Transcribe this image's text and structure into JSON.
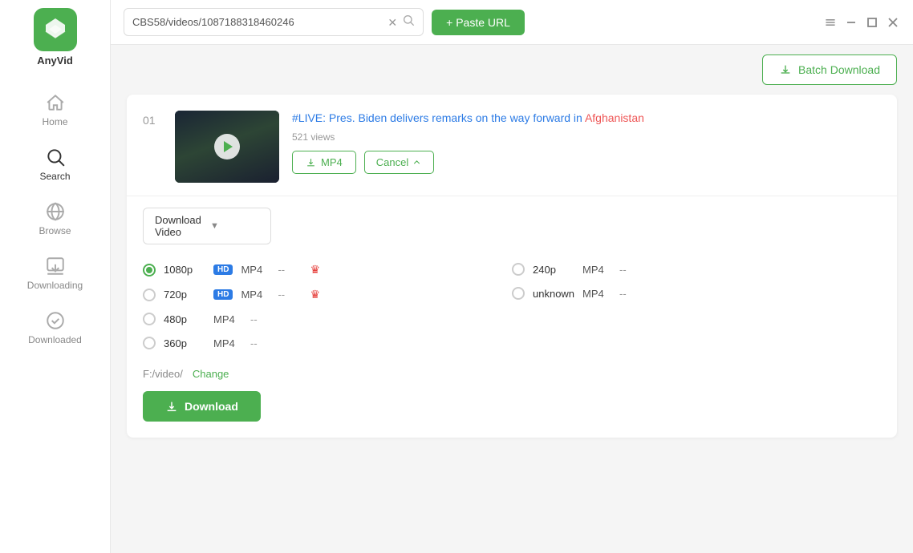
{
  "app": {
    "name": "AnyVid",
    "logo_alt": "AnyVid logo"
  },
  "sidebar": {
    "items": [
      {
        "id": "home",
        "label": "Home",
        "icon": "home-icon"
      },
      {
        "id": "search",
        "label": "Search",
        "icon": "search-icon",
        "active": true
      },
      {
        "id": "browse",
        "label": "Browse",
        "icon": "browse-icon"
      },
      {
        "id": "downloading",
        "label": "Downloading",
        "icon": "downloading-icon"
      },
      {
        "id": "downloaded",
        "label": "Downloaded",
        "icon": "downloaded-icon"
      }
    ]
  },
  "titlebar": {
    "url_value": "CBS58/videos/1087188318460246",
    "paste_url_label": "+ Paste URL",
    "window_controls": [
      "menu",
      "minimize",
      "maximize",
      "close"
    ]
  },
  "batch_download": {
    "label": "Batch Download"
  },
  "video": {
    "index": "01",
    "title_part1": "#LIVE: Pres. Biden delivers remarks on the way forward in",
    "title_highlight": "Afghanistan",
    "views": "521 views",
    "mp4_btn": "MP4",
    "cancel_btn": "Cancel"
  },
  "download_options": {
    "type_label": "Download Video",
    "qualities": [
      {
        "id": "1080p",
        "label": "1080p",
        "hd": true,
        "format": "MP4",
        "size": "--",
        "premium": true,
        "selected": true
      },
      {
        "id": "720p",
        "label": "720p",
        "hd": true,
        "format": "MP4",
        "size": "--",
        "premium": true,
        "selected": false
      },
      {
        "id": "480p",
        "label": "480p",
        "hd": false,
        "format": "MP4",
        "size": "--",
        "premium": false,
        "selected": false
      },
      {
        "id": "360p",
        "label": "360p",
        "hd": false,
        "format": "MP4",
        "size": "--",
        "premium": false,
        "selected": false
      },
      {
        "id": "240p",
        "label": "240p",
        "hd": false,
        "format": "MP4",
        "size": "--",
        "premium": false,
        "selected": false
      },
      {
        "id": "unknown",
        "label": "unknown",
        "hd": false,
        "format": "MP4",
        "size": "--",
        "premium": false,
        "selected": false
      }
    ],
    "save_path": "F:/video/",
    "change_label": "Change",
    "download_btn": "Download"
  }
}
